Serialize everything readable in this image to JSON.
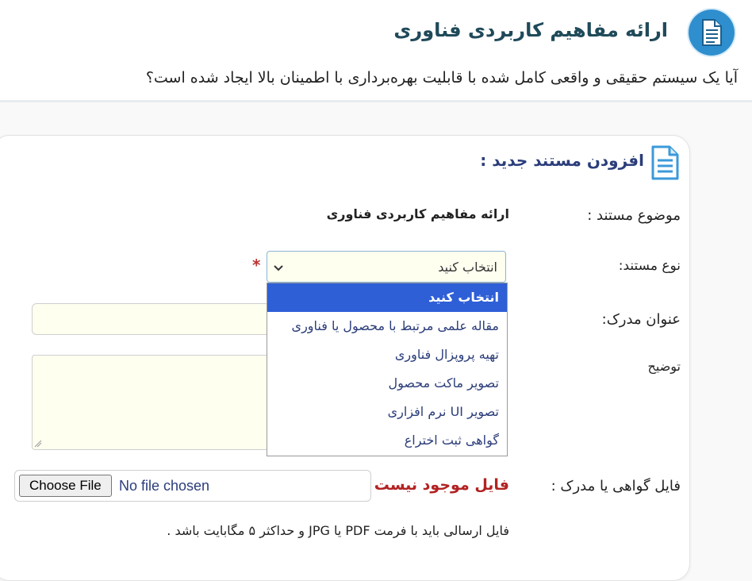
{
  "header": {
    "title": "ارائه مفاهیم کاربردی فناوری",
    "question": "آیا یک سیستم حقیقی و واقعی کامل شده با قابلیت بهره‌برداری با اطمینان بالا ایجاد شده است؟",
    "icon": "document-icon",
    "icon_color": "#2f8fce"
  },
  "form": {
    "title": "افزودن مستند جدید :",
    "subject_label": "موضوع مستند :",
    "subject_value": "ارائه مفاهیم کاربردی فناوری",
    "doc_type_label": "نوع مستند:",
    "doc_type_required": "*",
    "doc_type_selected": "انتخاب کنید",
    "doc_type_options": [
      "انتخاب کنید",
      "مقاله علمی مرتبط با محصول یا فناوری",
      "تهیه پروپزال فناوری",
      "تصویر ماکت محصول",
      "تصویر UI نرم افزاری",
      "گواهی ثبت اختراع"
    ],
    "proof_title_label": "عنوان مدرک:",
    "proof_title_value": "",
    "description_label": "توضیح",
    "description_value": "",
    "file_label": "فایل گواهی یا مدرک :",
    "file_button": "Choose File",
    "file_status": "No file chosen",
    "file_missing": "فایل موجود نیست",
    "file_hint": "فایل ارسالی باید با فرمت PDF یا JPG و حداکثر ۵ مگابایت باشد ."
  },
  "colors": {
    "accent": "#2e5fd7",
    "title": "#1f4a5a",
    "error": "#b22222",
    "input_bg": "#fffff0"
  }
}
